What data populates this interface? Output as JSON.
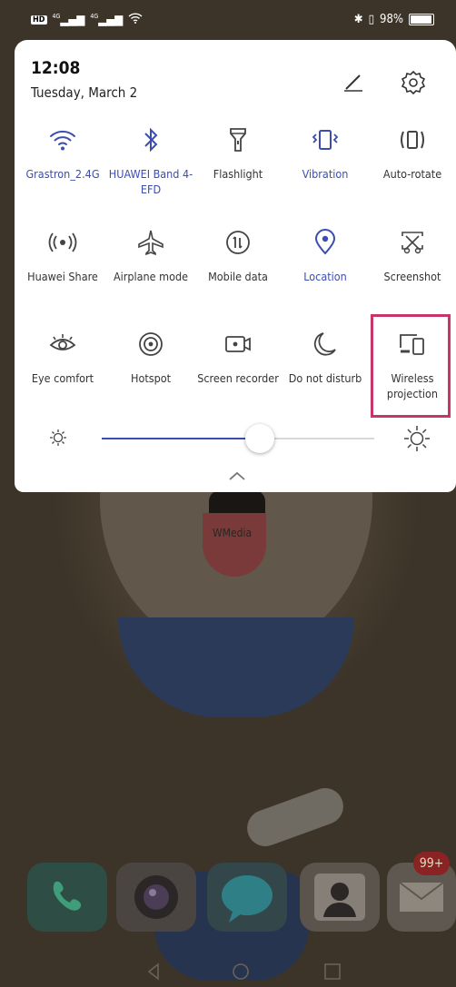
{
  "status_bar": {
    "left_icons": [
      "hd-icon",
      "signal-icon",
      "signal-icon",
      "wifi-icon"
    ],
    "hd_label": "HD",
    "network_1": "4G",
    "network_2": "4G",
    "battery_text": "98%"
  },
  "header": {
    "time": "12:08",
    "date": "Tuesday, March 2"
  },
  "tiles": [
    {
      "id": "wifi",
      "icon": "wifi-icon",
      "label": "Grastron_2.4G",
      "on": true
    },
    {
      "id": "bluetooth",
      "icon": "bluetooth-icon",
      "label": "HUAWEI Band 4-EFD",
      "on": true
    },
    {
      "id": "flashlight",
      "icon": "flashlight-icon",
      "label": "Flashlight",
      "on": false
    },
    {
      "id": "vibration",
      "icon": "vibration-icon",
      "label": "Vibration",
      "on": true
    },
    {
      "id": "auto-rotate",
      "icon": "auto-rotate-icon",
      "label": "Auto-rotate",
      "on": false
    },
    {
      "id": "huawei-share",
      "icon": "huawei-share-icon",
      "label": "Huawei Share",
      "on": false
    },
    {
      "id": "airplane-mode",
      "icon": "airplane-icon",
      "label": "Airplane mode",
      "on": false
    },
    {
      "id": "mobile-data",
      "icon": "mobile-data-icon",
      "label": "Mobile data",
      "on": false
    },
    {
      "id": "location",
      "icon": "location-icon",
      "label": "Location",
      "on": true
    },
    {
      "id": "screenshot",
      "icon": "screenshot-icon",
      "label": "Screenshot",
      "on": false
    },
    {
      "id": "eye-comfort",
      "icon": "eye-icon",
      "label": "Eye comfort",
      "on": false
    },
    {
      "id": "hotspot",
      "icon": "hotspot-icon",
      "label": "Hotspot",
      "on": false
    },
    {
      "id": "screen-recorder",
      "icon": "screen-recorder-icon",
      "label": "Screen recorder",
      "on": false
    },
    {
      "id": "do-not-disturb",
      "icon": "moon-icon",
      "label": "Do not disturb",
      "on": false
    },
    {
      "id": "wireless-projection",
      "icon": "wireless-projection-icon",
      "label": "Wireless projection",
      "on": false
    }
  ],
  "brightness": {
    "level": 0.58
  },
  "wallpaper": {
    "watermark": "WMedia"
  },
  "dock": {
    "apps": [
      "phone-icon",
      "camera-icon",
      "messages-icon",
      "contacts-icon",
      "email-icon"
    ],
    "email_badge": "99+"
  },
  "colors": {
    "accent": "#3b4db0",
    "highlight": "#c8356b"
  }
}
